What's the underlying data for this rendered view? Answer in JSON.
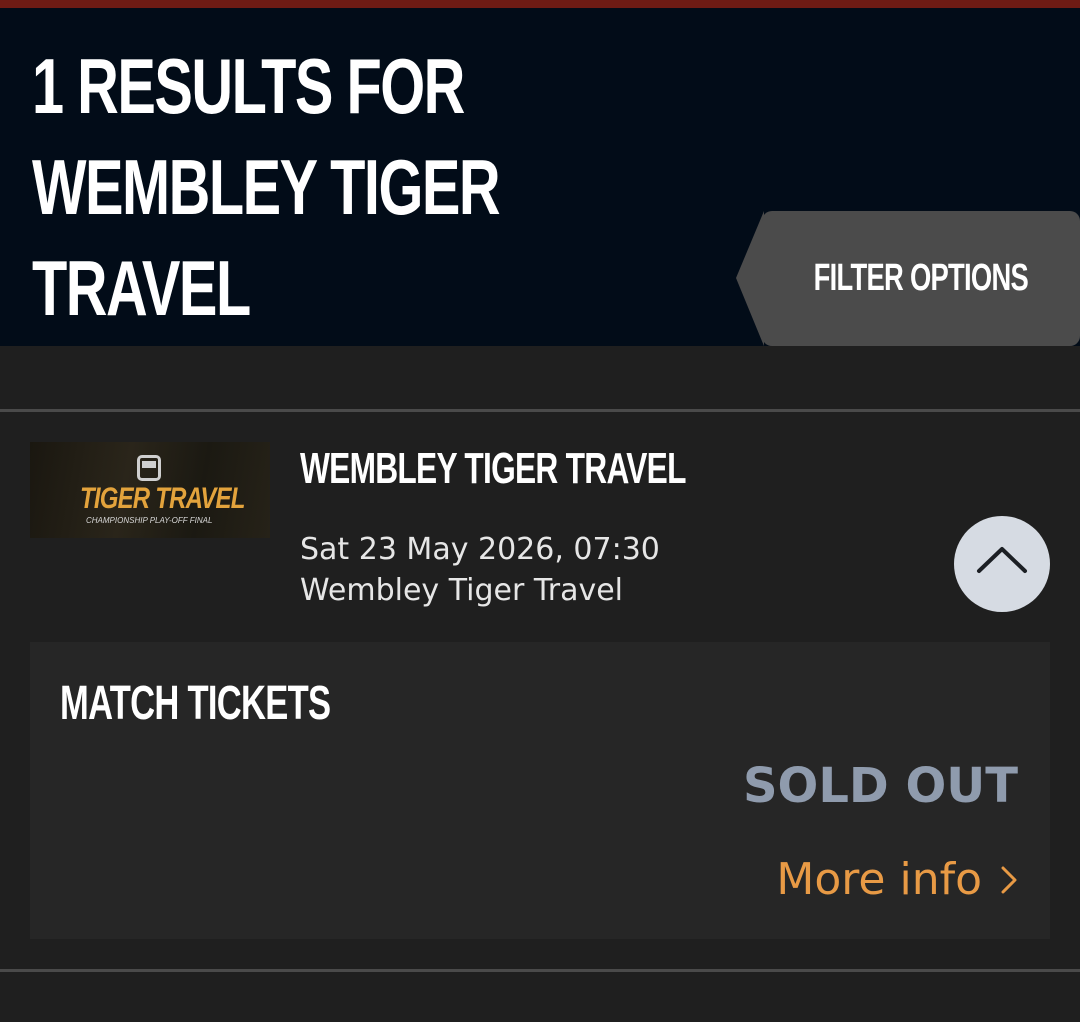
{
  "header": {
    "title_lines": [
      "1 RESULTS FOR",
      "WEMBLEY TIGER",
      "TRAVEL"
    ],
    "filter_label": "FILTER OPTIONS"
  },
  "event": {
    "thumbnail_title": "TIGER TRAVEL",
    "thumbnail_subtitle": "CHAMPIONSHIP PLAY-OFF FINAL",
    "title": "WEMBLEY TIGER TRAVEL",
    "date": "Sat 23 May 2026, 07:30",
    "venue": "Wembley Tiger Travel",
    "collapse_icon": "chevron-up-icon"
  },
  "tickets": {
    "heading": "MATCH TICKETS",
    "status": "SOLD OUT",
    "more_info_label": "More info",
    "more_info_icon": "chevron-right-icon"
  },
  "colors": {
    "header_bg": "#020c18",
    "page_bg": "#1f1f1f",
    "accent": "#e89a45",
    "status": "#8f9bad"
  }
}
